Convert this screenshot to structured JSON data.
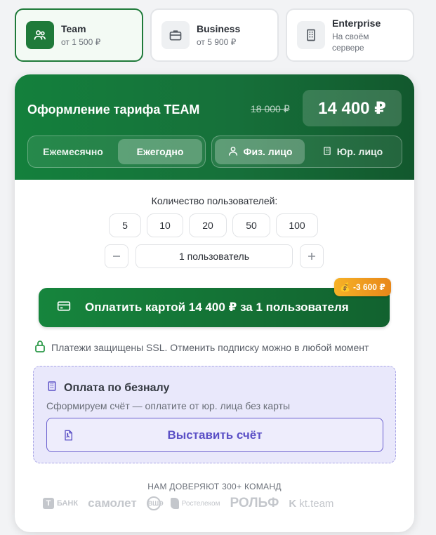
{
  "plans": [
    {
      "name": "Team",
      "price": "от 1 500 ₽",
      "active": true
    },
    {
      "name": "Business",
      "price": "от 5 900 ₽"
    },
    {
      "name": "Enterprise",
      "price": "На своём сервере"
    }
  ],
  "header": {
    "title": "Оформление тарифа TEAM",
    "old_price": "18 000 ₽",
    "price": "14 400 ₽"
  },
  "period": {
    "monthly": "Ежемесячно",
    "yearly": "Ежегодно",
    "selected": "yearly"
  },
  "person": {
    "individual": "Физ. лицо",
    "legal": "Юр. лицо",
    "selected": "individual"
  },
  "users": {
    "label": "Количество пользователей:",
    "options": [
      "5",
      "10",
      "20",
      "50",
      "100"
    ],
    "value": "1 пользователь"
  },
  "pay": {
    "label": "Оплатить картой 14 400 ₽ за 1 пользователя",
    "discount": "-3 600 ₽"
  },
  "ssl_note": "Платежи защищены SSL. Отменить подписку можно в любой момент",
  "invoice": {
    "title": "Оплата по безналу",
    "subtitle": "Сформируем счёт — оплатите от юр. лица без карты",
    "button": "Выставить счёт"
  },
  "trust": {
    "title": "НАМ ДОВЕРЯЮТ 300+ КОМАНД",
    "logos": [
      "Т БАНК",
      "самолет",
      "ВШЭ",
      "Ростелеком",
      "РОЛЬФ",
      "kt.team"
    ]
  },
  "colors": {
    "brand": "#1f7a3a",
    "accent": "#5b50c6",
    "badge": "#f0a020"
  }
}
